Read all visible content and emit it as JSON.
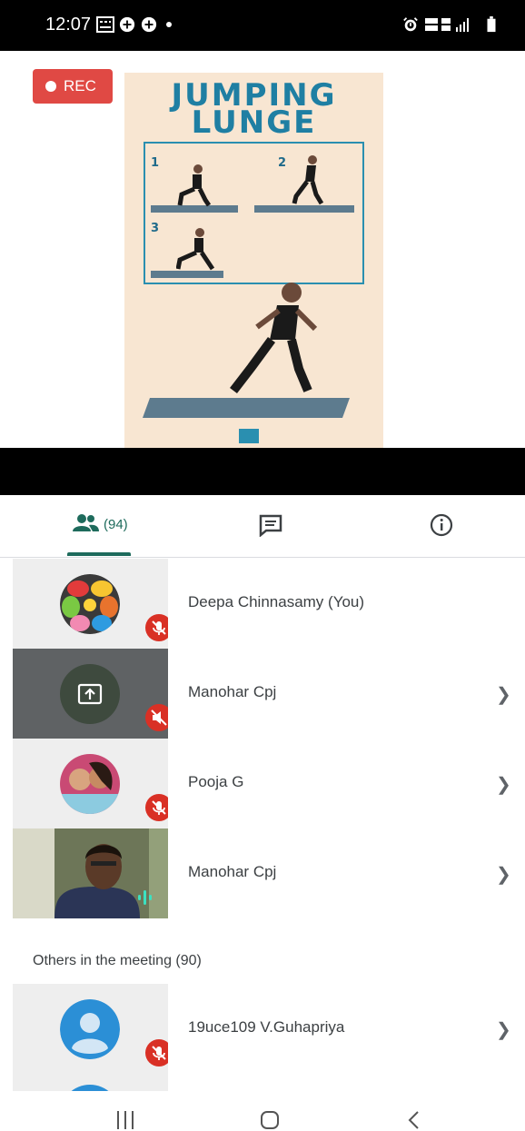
{
  "status_bar": {
    "time": "12:07"
  },
  "video": {
    "rec_label": "REC",
    "poster": {
      "title_line1": "JUMPING",
      "title_line2": "LUNGE",
      "steps": [
        "1",
        "2",
        "3"
      ]
    }
  },
  "tabs": {
    "people_count": "(94)"
  },
  "participants": [
    {
      "name": "Deepa Chinnasamy (You)",
      "muted": true
    },
    {
      "name": "Manohar Cpj",
      "muted": true,
      "presenting": true
    },
    {
      "name": "Pooja G",
      "muted": true
    },
    {
      "name": "Manohar Cpj",
      "speaking": true
    }
  ],
  "others": {
    "label": "Others in the meeting (90)",
    "items": [
      {
        "name": "19uce109 V.Guhapriya",
        "muted": true
      }
    ]
  },
  "colors": {
    "accent": "#1e6b5c",
    "mute": "#d93025",
    "rec": "#e04944"
  }
}
